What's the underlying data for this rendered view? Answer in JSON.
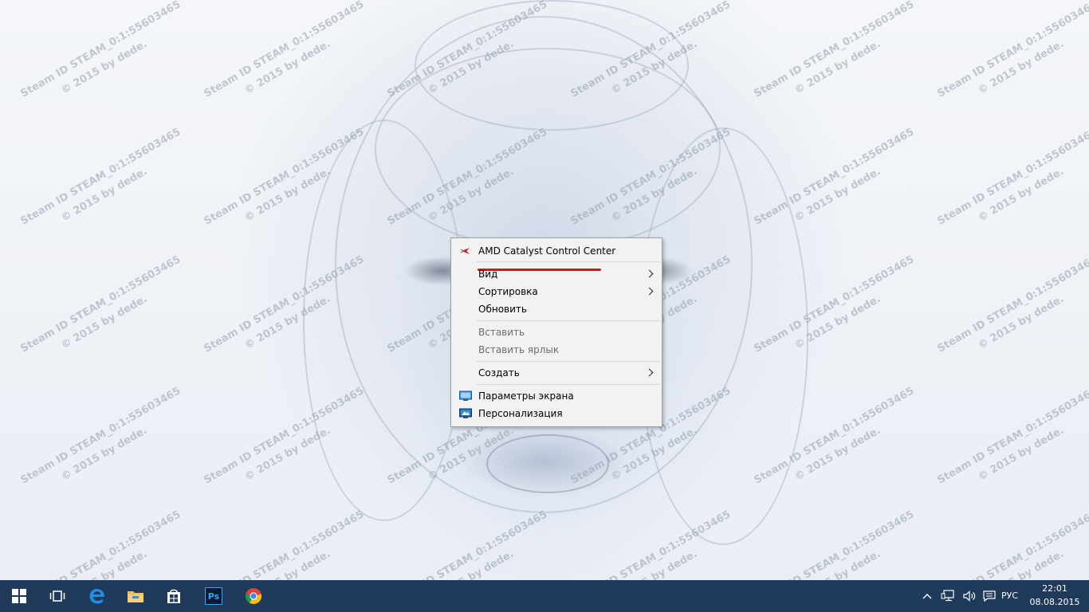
{
  "watermark": {
    "line1": "Steam ID  STEAM_0:1:55603465",
    "line2": "© 2015 by dede."
  },
  "context_menu": {
    "items": [
      {
        "label": "AMD Catalyst Control Center",
        "icon": "amd-catalyst-icon"
      },
      {
        "label": "Вид",
        "submenu": true
      },
      {
        "label": "Сортировка",
        "submenu": true
      },
      {
        "label": "Обновить"
      },
      {
        "label": "Вставить",
        "disabled": true
      },
      {
        "label": "Вставить ярлык",
        "disabled": true
      },
      {
        "label": "Создать",
        "submenu": true
      },
      {
        "label": "Параметры экрана",
        "icon": "display-settings-icon"
      },
      {
        "label": "Персонализация",
        "icon": "personalization-icon"
      }
    ],
    "highlight_color": "#d1151d"
  },
  "taskbar": {
    "background": "#1f3a5a",
    "apps": [
      "start-icon",
      "task-view-icon",
      "edge-icon",
      "file-explorer-icon",
      "store-icon",
      "photoshop-icon",
      "chrome-icon"
    ],
    "photoshop_label": "Ps",
    "language": "РУС",
    "time": "22:01",
    "date": "08.08.2015"
  }
}
